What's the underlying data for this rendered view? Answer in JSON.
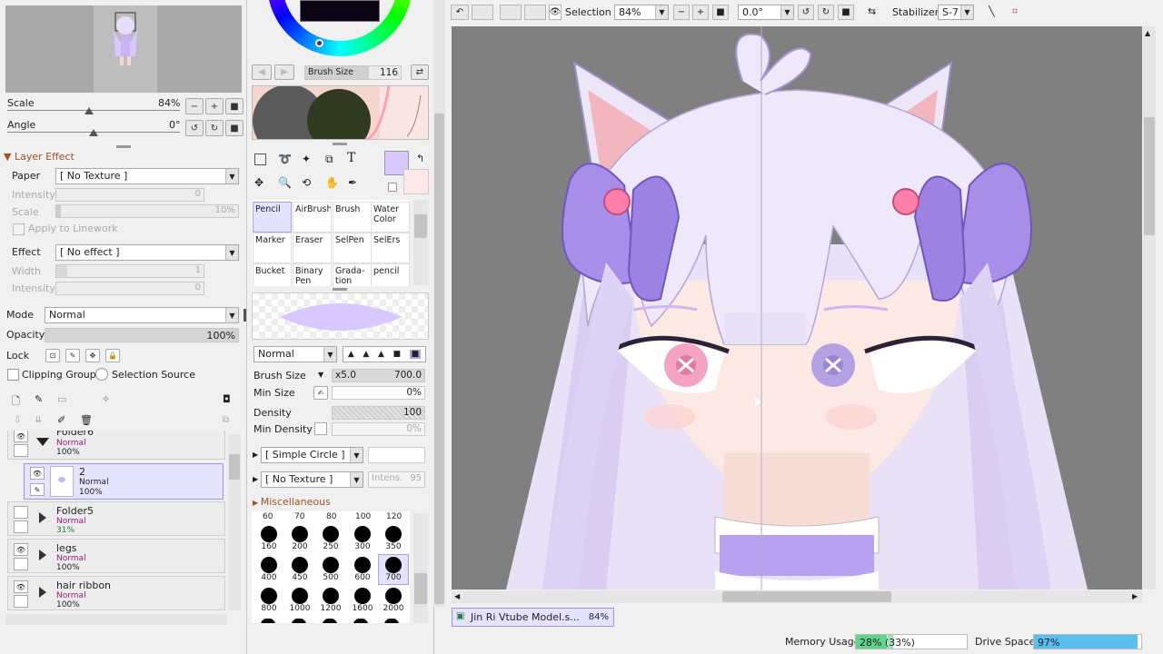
{
  "navigator": {
    "scale_label": "Scale",
    "scale_value": "84%",
    "angle_label": "Angle",
    "angle_value": "0°"
  },
  "layer_effect": {
    "header": "Layer Effect",
    "paper_label": "Paper",
    "paper_value": "[ No Texture ]",
    "intensity_label": "Intensity",
    "intensity_value": "0",
    "scale_label": "Scale",
    "scale_value": "10%",
    "apply_linework": "Apply to Linework",
    "effect_label": "Effect",
    "effect_value": "[ No effect ]",
    "width_label": "Width",
    "width_value": "1",
    "intensity2_label": "Intensity",
    "intensity2_value": "0"
  },
  "layer_props": {
    "mode_label": "Mode",
    "mode_value": "Normal",
    "opacity_label": "Opacity",
    "opacity_value": "100%",
    "lock_label": "Lock",
    "clipping_group": "Clipping Group",
    "selection_source": "Selection Source"
  },
  "layers": [
    {
      "name": "Folder6",
      "mode": "Normal",
      "opacity": "100%"
    },
    {
      "name": "2",
      "mode": "Normal",
      "opacity": "100%"
    },
    {
      "name": "Folder5",
      "mode": "Normal",
      "opacity": "31%"
    },
    {
      "name": "legs",
      "mode": "Normal",
      "opacity": "100%"
    },
    {
      "name": "hair ribbon",
      "mode": "Normal",
      "opacity": "100%"
    }
  ],
  "brush_size_top": {
    "label": "Brush Size",
    "value": "116"
  },
  "tools": [
    {
      "name": "Pencil"
    },
    {
      "name": "AirBrush"
    },
    {
      "name": "Brush"
    },
    {
      "name": "Water Color"
    },
    {
      "name": "Marker"
    },
    {
      "name": "Eraser"
    },
    {
      "name": "SelPen"
    },
    {
      "name": "SelErs"
    },
    {
      "name": "Bucket"
    },
    {
      "name": "Binary Pen"
    },
    {
      "name": "Grada-tion"
    },
    {
      "name": "pencil"
    }
  ],
  "brush_settings": {
    "mode_value": "Normal",
    "brush_size_label": "Brush Size",
    "brush_size_mult": "x5.0",
    "brush_size_value": "700.0",
    "min_size_label": "Min Size",
    "min_size_value": "0%",
    "density_label": "Density",
    "density_value": "100",
    "min_density_label": "Min Density",
    "min_density_value": "0%",
    "shape_value": "[ Simple Circle ]",
    "texture_value": "[ No Texture ]",
    "intens_label": "Intens.",
    "intens_value": "95",
    "misc_label": "Miscellaneous"
  },
  "brush_sizes_header": [
    "60",
    "70",
    "80",
    "100",
    "120"
  ],
  "brush_sizes_rows": [
    [
      "160",
      "200",
      "250",
      "300",
      "350"
    ],
    [
      "400",
      "450",
      "500",
      "600",
      "700"
    ],
    [
      "800",
      "1000",
      "1200",
      "1600",
      "2000"
    ]
  ],
  "toolbar": {
    "selection_label": "Selection",
    "zoom_value": "84%",
    "rotation_value": "0.0°",
    "stabilizer_label": "Stabilizer",
    "stabilizer_value": "S-7"
  },
  "document_tab": {
    "name": "Jin Ri Vtube Model.s...",
    "zoom": "84%"
  },
  "status": {
    "memory_label": "Memory Usage",
    "memory_value": "28% (33%)",
    "memory_fraction": 0.28,
    "drive_label": "Drive Space",
    "drive_value": "97%",
    "drive_fraction": 0.97
  },
  "colors": {
    "main_color": "#d7c8ff",
    "sub_color": "#fde7e7",
    "selected_bg": "#e3e2ff",
    "canvas_bg": "#808080"
  }
}
